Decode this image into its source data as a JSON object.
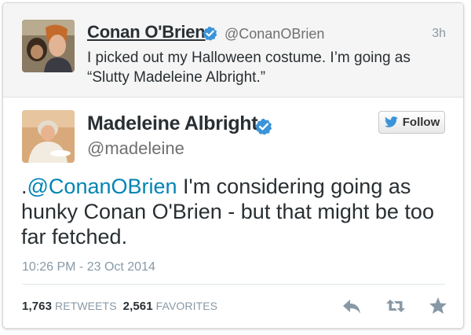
{
  "parent_tweet": {
    "name": "Conan O'Brien",
    "handle": "@ConanOBrien",
    "time": "3h",
    "text": "I picked out my Halloween costume. I’m going as “Slutty Madeleine Albright.”"
  },
  "main_tweet": {
    "name": "Madeleine Albright",
    "handle": "@madeleine",
    "follow_label": "Follow",
    "text_prefix": ".",
    "mention": "@ConanOBrien",
    "text_rest": " I'm considering going as hunky Conan O'Brien - but that might be too far fetched.",
    "timestamp": "10:26 PM - 23 Oct 2014",
    "retweets_count": "1,763",
    "retweets_label": "RETWEETS",
    "favorites_count": "2,561",
    "favorites_label": "FAVORITES"
  },
  "colors": {
    "verified": "#3b94d9",
    "mention": "#0084b4",
    "icon": "#8899a6"
  },
  "icons": [
    "verified-badge-icon",
    "twitter-bird-icon",
    "reply-icon",
    "retweet-icon",
    "favorite-star-icon"
  ]
}
